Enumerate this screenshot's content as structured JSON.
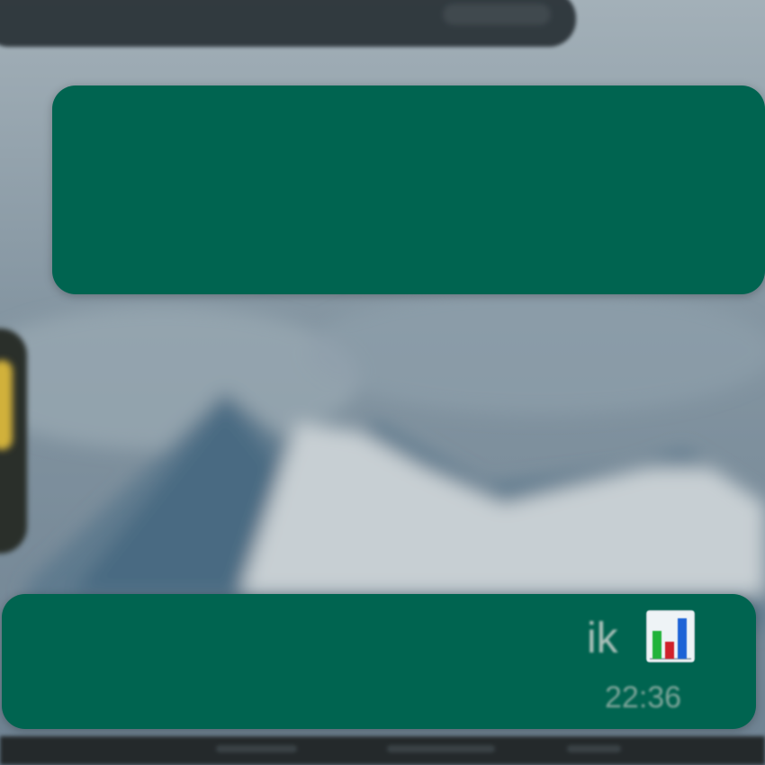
{
  "chat": {
    "header_preview": "",
    "messages": [
      {
        "text": "",
        "time": ""
      },
      {
        "text_visible_tail": "ik",
        "emoji": "chart-emoji",
        "time": "22:36"
      }
    ]
  },
  "colors": {
    "bubble_outgoing": "#006450",
    "header_pill": "#2b3338",
    "wallpaper_sky": "#7d8f9c"
  }
}
